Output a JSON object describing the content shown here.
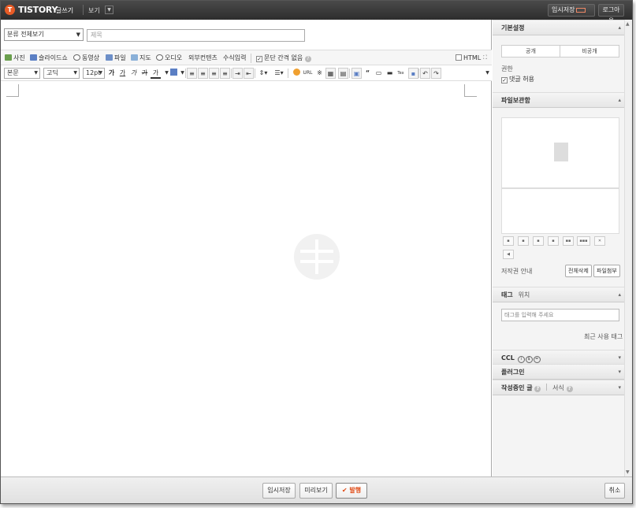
{
  "topbar": {
    "logo_letter": "T",
    "brand": "TISTORY",
    "subtitle": "글쓰기",
    "view_label": "보기",
    "temp_save_label": "임시저장",
    "logout_label": "로그아웃",
    "accent_color": "#e85b25"
  },
  "editor": {
    "category": "분류 전체보기",
    "title_placeholder": "제목",
    "insert_toolbar": {
      "photo": "사진",
      "slideshow": "슬라이드쇼",
      "video": "동영상",
      "file": "파일",
      "map": "지도",
      "audio": "오디오",
      "external": "외부컨텐츠",
      "formula": "수식입력",
      "no_paragraph_spacing": "문단 간격 없음",
      "html": "HTML"
    },
    "format_toolbar": {
      "paragraph": "본문",
      "font": "고딕",
      "size": "12pt",
      "bold": "가",
      "underline": "가",
      "italic": "가",
      "strike": "가",
      "color": "가",
      "url": "URL"
    }
  },
  "sidebar": {
    "basic_settings": {
      "title": "기본설정",
      "public": "공개",
      "private": "비공개",
      "permission_label": "권한",
      "allow_comments": "댓글 허용"
    },
    "file_storage": {
      "title": "파일보관함",
      "copyright": "저작권 안내",
      "delete_all": "전체삭제",
      "attach_file": "파일첨부",
      "icons": [
        "align-left-icon",
        "align-center-icon",
        "align-right-icon",
        "layout-icon",
        "layout-double-icon",
        "layout-triple-icon",
        "delete-icon",
        "audio-icon"
      ]
    },
    "tag": {
      "title": "태그",
      "location": "위치",
      "placeholder": "태그를 입력해 주세요",
      "recent_tags": "최근 사용 태그"
    },
    "ccl": {
      "title": "CCL"
    },
    "plugin": {
      "title": "플러그인"
    },
    "writing": {
      "title": "작성중인 글",
      "format": "서식"
    }
  },
  "bottom": {
    "temp_save": "임시저장",
    "preview": "미리보기",
    "publish": "발행",
    "cancel": "취소"
  }
}
